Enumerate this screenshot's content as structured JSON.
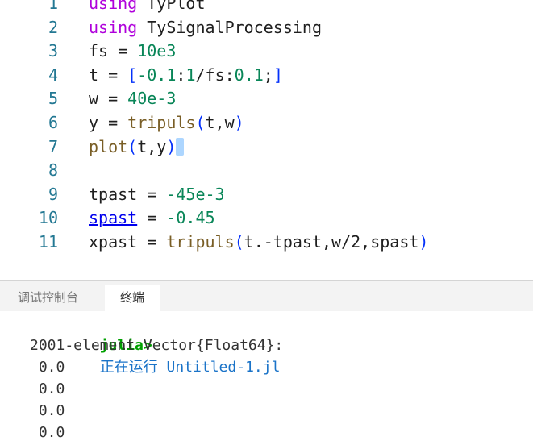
{
  "editor": {
    "lines": [
      {
        "num": "1",
        "tokens": [
          {
            "t": "using",
            "c": "kw"
          },
          {
            "t": " TyPlot",
            "c": ""
          }
        ]
      },
      {
        "num": "2",
        "tokens": [
          {
            "t": "using",
            "c": "kw"
          },
          {
            "t": " TySignalProcessing",
            "c": ""
          }
        ]
      },
      {
        "num": "3",
        "tokens": [
          {
            "t": "fs = ",
            "c": ""
          },
          {
            "t": "10e3",
            "c": "num"
          }
        ]
      },
      {
        "num": "4",
        "tokens": [
          {
            "t": "t = ",
            "c": ""
          },
          {
            "t": "[",
            "c": "br1"
          },
          {
            "t": "-0.1",
            "c": "num"
          },
          {
            "t": ":",
            "c": ""
          },
          {
            "t": "1",
            "c": "num"
          },
          {
            "t": "/fs:",
            "c": ""
          },
          {
            "t": "0.1",
            "c": "num"
          },
          {
            "t": ";",
            "c": ""
          },
          {
            "t": "]",
            "c": "br1"
          }
        ]
      },
      {
        "num": "5",
        "tokens": [
          {
            "t": "w = ",
            "c": ""
          },
          {
            "t": "40e-3",
            "c": "num"
          }
        ]
      },
      {
        "num": "6",
        "tokens": [
          {
            "t": "y = ",
            "c": ""
          },
          {
            "t": "tripuls",
            "c": "fn"
          },
          {
            "t": "(",
            "c": "br1"
          },
          {
            "t": "t,w",
            "c": ""
          },
          {
            "t": ")",
            "c": "br1"
          }
        ]
      },
      {
        "num": "7",
        "tokens": [
          {
            "t": "plot",
            "c": "fn"
          },
          {
            "t": "(",
            "c": "br1"
          },
          {
            "t": "t,y",
            "c": ""
          },
          {
            "t": ")",
            "c": "br1"
          }
        ],
        "cursor": true
      },
      {
        "num": "8",
        "tokens": []
      },
      {
        "num": "9",
        "tokens": [
          {
            "t": "tpast = ",
            "c": ""
          },
          {
            "t": "-45e-3",
            "c": "num"
          }
        ]
      },
      {
        "num": "10",
        "tokens": [
          {
            "t": "spast",
            "c": "ident-link"
          },
          {
            "t": " = ",
            "c": ""
          },
          {
            "t": "-0.45",
            "c": "num"
          }
        ]
      },
      {
        "num": "11",
        "tokens": [
          {
            "t": "xpast = ",
            "c": ""
          },
          {
            "t": "tripuls",
            "c": "fn"
          },
          {
            "t": "(",
            "c": "br1"
          },
          {
            "t": "t.-tpast,w/2,spast",
            "c": ""
          },
          {
            "t": ")",
            "c": "br1"
          }
        ]
      }
    ]
  },
  "panel": {
    "tabs": [
      {
        "label": "调试控制台",
        "active": false
      },
      {
        "label": "终端",
        "active": true
      }
    ]
  },
  "terminal": {
    "prompt": "julia>",
    "running_text": "正在运行 Untitled-1.jl",
    "output_lines": [
      "2001-element Vector{Float64}:",
      " 0.0",
      " 0.0",
      " 0.0",
      " 0.0"
    ]
  },
  "colors": {
    "keyword": "#af00db",
    "number": "#098658",
    "function": "#795e26",
    "bracket": "#0431fa",
    "line_number": "#237893",
    "prompt": "#00a000",
    "running": "#1a73c8"
  }
}
